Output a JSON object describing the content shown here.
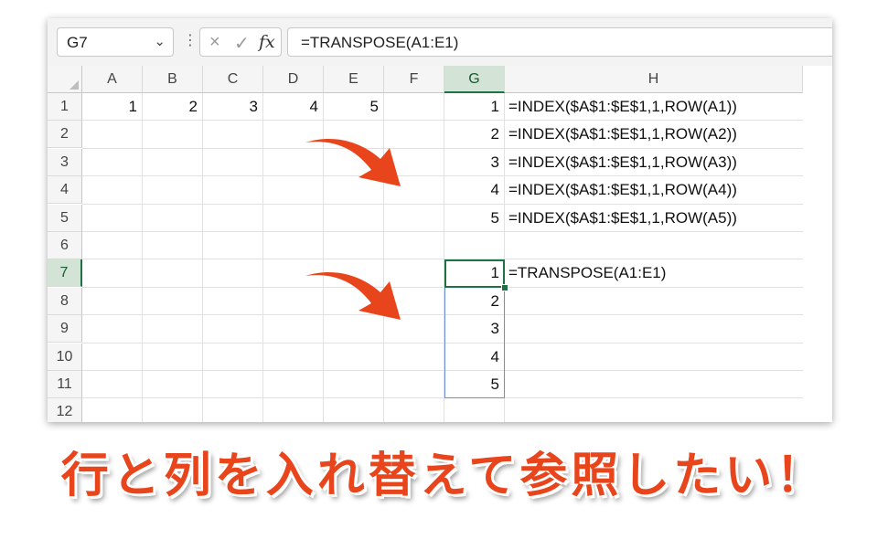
{
  "formula_bar": {
    "name_box": "G7",
    "formula": "=TRANSPOSE(A1:E1)"
  },
  "columns": [
    "A",
    "B",
    "C",
    "D",
    "E",
    "F",
    "G",
    "H"
  ],
  "rows": [
    "1",
    "2",
    "3",
    "4",
    "5",
    "6",
    "7",
    "8",
    "9",
    "10",
    "11",
    "12"
  ],
  "cells": {
    "A1": "1",
    "B1": "2",
    "C1": "3",
    "D1": "4",
    "E1": "5",
    "G1": "1",
    "G2": "2",
    "G3": "3",
    "G4": "4",
    "G5": "5",
    "H1": "=INDEX($A$1:$E$1,1,ROW(A1))",
    "H2": "=INDEX($A$1:$E$1,1,ROW(A2))",
    "H3": "=INDEX($A$1:$E$1,1,ROW(A3))",
    "H4": "=INDEX($A$1:$E$1,1,ROW(A4))",
    "H5": "=INDEX($A$1:$E$1,1,ROW(A5))",
    "G7": "1",
    "G8": "2",
    "G9": "3",
    "G10": "4",
    "G11": "5",
    "H7": "=TRANSPOSE(A1:E1)"
  },
  "icons": {
    "cancel": "×",
    "confirm": "✓",
    "function": "fx",
    "dropdown": "⌄",
    "more": "⋮"
  },
  "caption": "行と列を入れ替えて参照したい！",
  "colors": {
    "accent_green": "#1e7145",
    "arrow_red": "#e8451c",
    "caption_red": "#e8451c"
  }
}
